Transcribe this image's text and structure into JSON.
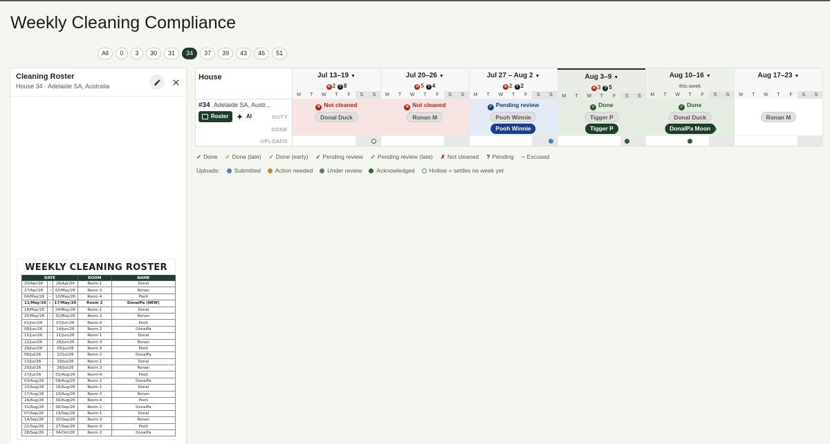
{
  "page": {
    "title": "Weekly Cleaning Compliance"
  },
  "house_filter": [
    "All",
    "0",
    "3",
    "30",
    "31",
    "34",
    "37",
    "39",
    "43",
    "46",
    "51"
  ],
  "house_filter_active": "34",
  "side_panel": {
    "title": "Cleaning Roster",
    "subtitle": "House 34 · Adelaide SA, Australia",
    "roster_title": "WEEKLY CLEANING ROSTER",
    "columns": [
      "DATE",
      "ROOM",
      "NAME"
    ],
    "rows": [
      [
        "20/Apr/26",
        "26/Apr/26",
        "Room 1",
        "Donal"
      ],
      [
        "27/Apr/26",
        "03/May/26",
        "Room 3",
        "Ronan"
      ],
      [
        "04/May/26",
        "10/May/26",
        "Room 4",
        "Pooh"
      ],
      [
        "11/May/26",
        "17/May/26",
        "Room 2",
        "DonalPa (NEW)"
      ],
      [
        "18/May/26",
        "24/May/26",
        "Room 1",
        "Donal"
      ],
      [
        "25/May/26",
        "31/May/26",
        "Room 3",
        "Ronan"
      ],
      [
        "01/Jun/26",
        "07/Jun/26",
        "Room 4",
        "Pooh"
      ],
      [
        "08/Jun/26",
        "14/Jun/26",
        "Room 2",
        "DonalPa"
      ],
      [
        "15/Jun/26",
        "21/Jun/26",
        "Room 1",
        "Donal"
      ],
      [
        "22/Jun/26",
        "28/Jun/26",
        "Room 3",
        "Ronan"
      ],
      [
        "29/Jun/26",
        "05/Jul/26",
        "Room 4",
        "Pooh"
      ],
      [
        "06/Jul/26",
        "12/Jul/26",
        "Room 2",
        "DonalPa"
      ],
      [
        "13/Jul/26",
        "19/Jul/26",
        "Room 1",
        "Donal"
      ],
      [
        "20/Jul/26",
        "26/Jul/26",
        "Room 3",
        "Ronan"
      ],
      [
        "27/Jul/26",
        "02/Aug/26",
        "Room 4",
        "Pooh"
      ],
      [
        "03/Aug/26",
        "09/Aug/26",
        "Room 2",
        "DonalPa"
      ],
      [
        "10/Aug/26",
        "16/Aug/26",
        "Room 1",
        "Donal"
      ],
      [
        "17/Aug/26",
        "23/Aug/26",
        "Room 3",
        "Ronan"
      ],
      [
        "24/Aug/26",
        "30/Aug/26",
        "Room 4",
        "Pooh"
      ],
      [
        "31/Aug/26",
        "06/Sep/26",
        "Room 2",
        "DonalPa"
      ],
      [
        "07/Sep/26",
        "13/Sep/26",
        "Room 1",
        "Donal"
      ],
      [
        "14/Sep/26",
        "20/Sep/26",
        "Room 3",
        "Ronan"
      ],
      [
        "21/Sep/26",
        "27/Sep/26",
        "Room 4",
        "Pooh"
      ],
      [
        "28/Sep/26",
        "04/Oct/26",
        "Room 2",
        "DonalPa"
      ]
    ],
    "bold_row": 3
  },
  "grid": {
    "house_header": "House",
    "house_num": "#34",
    "house_loc": "Adelaide SA, Austr...",
    "roster_label": "Roster",
    "ai_label": "AI",
    "row_labels": {
      "duty": "DUTY",
      "done": "DONE",
      "uploads": "UPLOADS"
    },
    "day_letters": [
      "M",
      "T",
      "W",
      "T",
      "F",
      "S",
      "S"
    ],
    "weeks": [
      {
        "label": "Jul 13–19",
        "x_count": "2",
        "q_count": "8",
        "status": "Not cleaned",
        "status_kind": "red",
        "duty": "Donal Duck",
        "done": "",
        "uploads": [
          null,
          null,
          null,
          null,
          null,
          null,
          "hollow"
        ]
      },
      {
        "label": "Jul 20–26",
        "x_count": "5",
        "q_count": "4",
        "status": "Not cleaned",
        "status_kind": "red",
        "duty": "Ronan M",
        "done": "",
        "uploads": [
          null,
          null,
          null,
          null,
          null,
          null,
          null
        ]
      },
      {
        "label": "Jul 27 – Aug 2",
        "x_count": "2",
        "q_count": "2",
        "status": "Pending review",
        "status_kind": "blue",
        "duty": "Pooh Winnie",
        "done": "Pooh Winnie",
        "uploads": [
          null,
          null,
          null,
          null,
          null,
          null,
          "blue"
        ]
      },
      {
        "label": "Aug 3–9",
        "x_count": "3",
        "q_count": "5",
        "status": "Done",
        "status_kind": "green",
        "duty": "Tigger P",
        "done": "Tigger P",
        "current": true,
        "uploads": [
          null,
          null,
          null,
          null,
          null,
          "green",
          null
        ]
      },
      {
        "label": "Aug 10–16",
        "sub": "this week",
        "status": "Done",
        "status_kind": "green",
        "duty": "Donal Duck",
        "done": "DonalPa Moon",
        "this": true,
        "done_hollow": true,
        "uploads": [
          null,
          null,
          null,
          "green",
          null,
          null,
          null
        ]
      },
      {
        "label": "Aug 17–23",
        "status": "",
        "status_kind": "white",
        "duty": "Ronan M",
        "done": "",
        "uploads": [
          null,
          null,
          null,
          null,
          null,
          null,
          null
        ]
      }
    ]
  },
  "legend": [
    {
      "mark": "✓",
      "color": "#2f5a2f",
      "label": "Done"
    },
    {
      "mark": "✓",
      "color": "#c77a1a",
      "label": "Done (late)"
    },
    {
      "mark": "✓",
      "color": "#5a8a4a",
      "label": "Done (early)"
    },
    {
      "mark": "✓",
      "color": "#1a3e8a",
      "label": "Pending review"
    },
    {
      "mark": "✓",
      "color": "#7b4aa8",
      "label": "Pending review (late)"
    },
    {
      "mark": "✗",
      "color": "#b3261e",
      "label": "Not cleaned"
    },
    {
      "mark": "?",
      "color": "#222222",
      "label": "Pending"
    },
    {
      "mark": "~",
      "color": "#666666",
      "label": "Excused"
    }
  ],
  "uploads_legend": {
    "label": "Uploads:",
    "items": [
      {
        "color": "#4a7fc4",
        "label": "Submitted",
        "hollow": false
      },
      {
        "color": "#e07a2a",
        "label": "Action needed",
        "hollow": false
      },
      {
        "color": "#5a7a5a",
        "label": "Under review",
        "hollow": false
      },
      {
        "color": "#2f6a2f",
        "label": "Acknowledged",
        "hollow": false
      },
      {
        "color": "#4a7fc4",
        "label": "Hollow = settles no week yet",
        "hollow": true
      }
    ]
  }
}
